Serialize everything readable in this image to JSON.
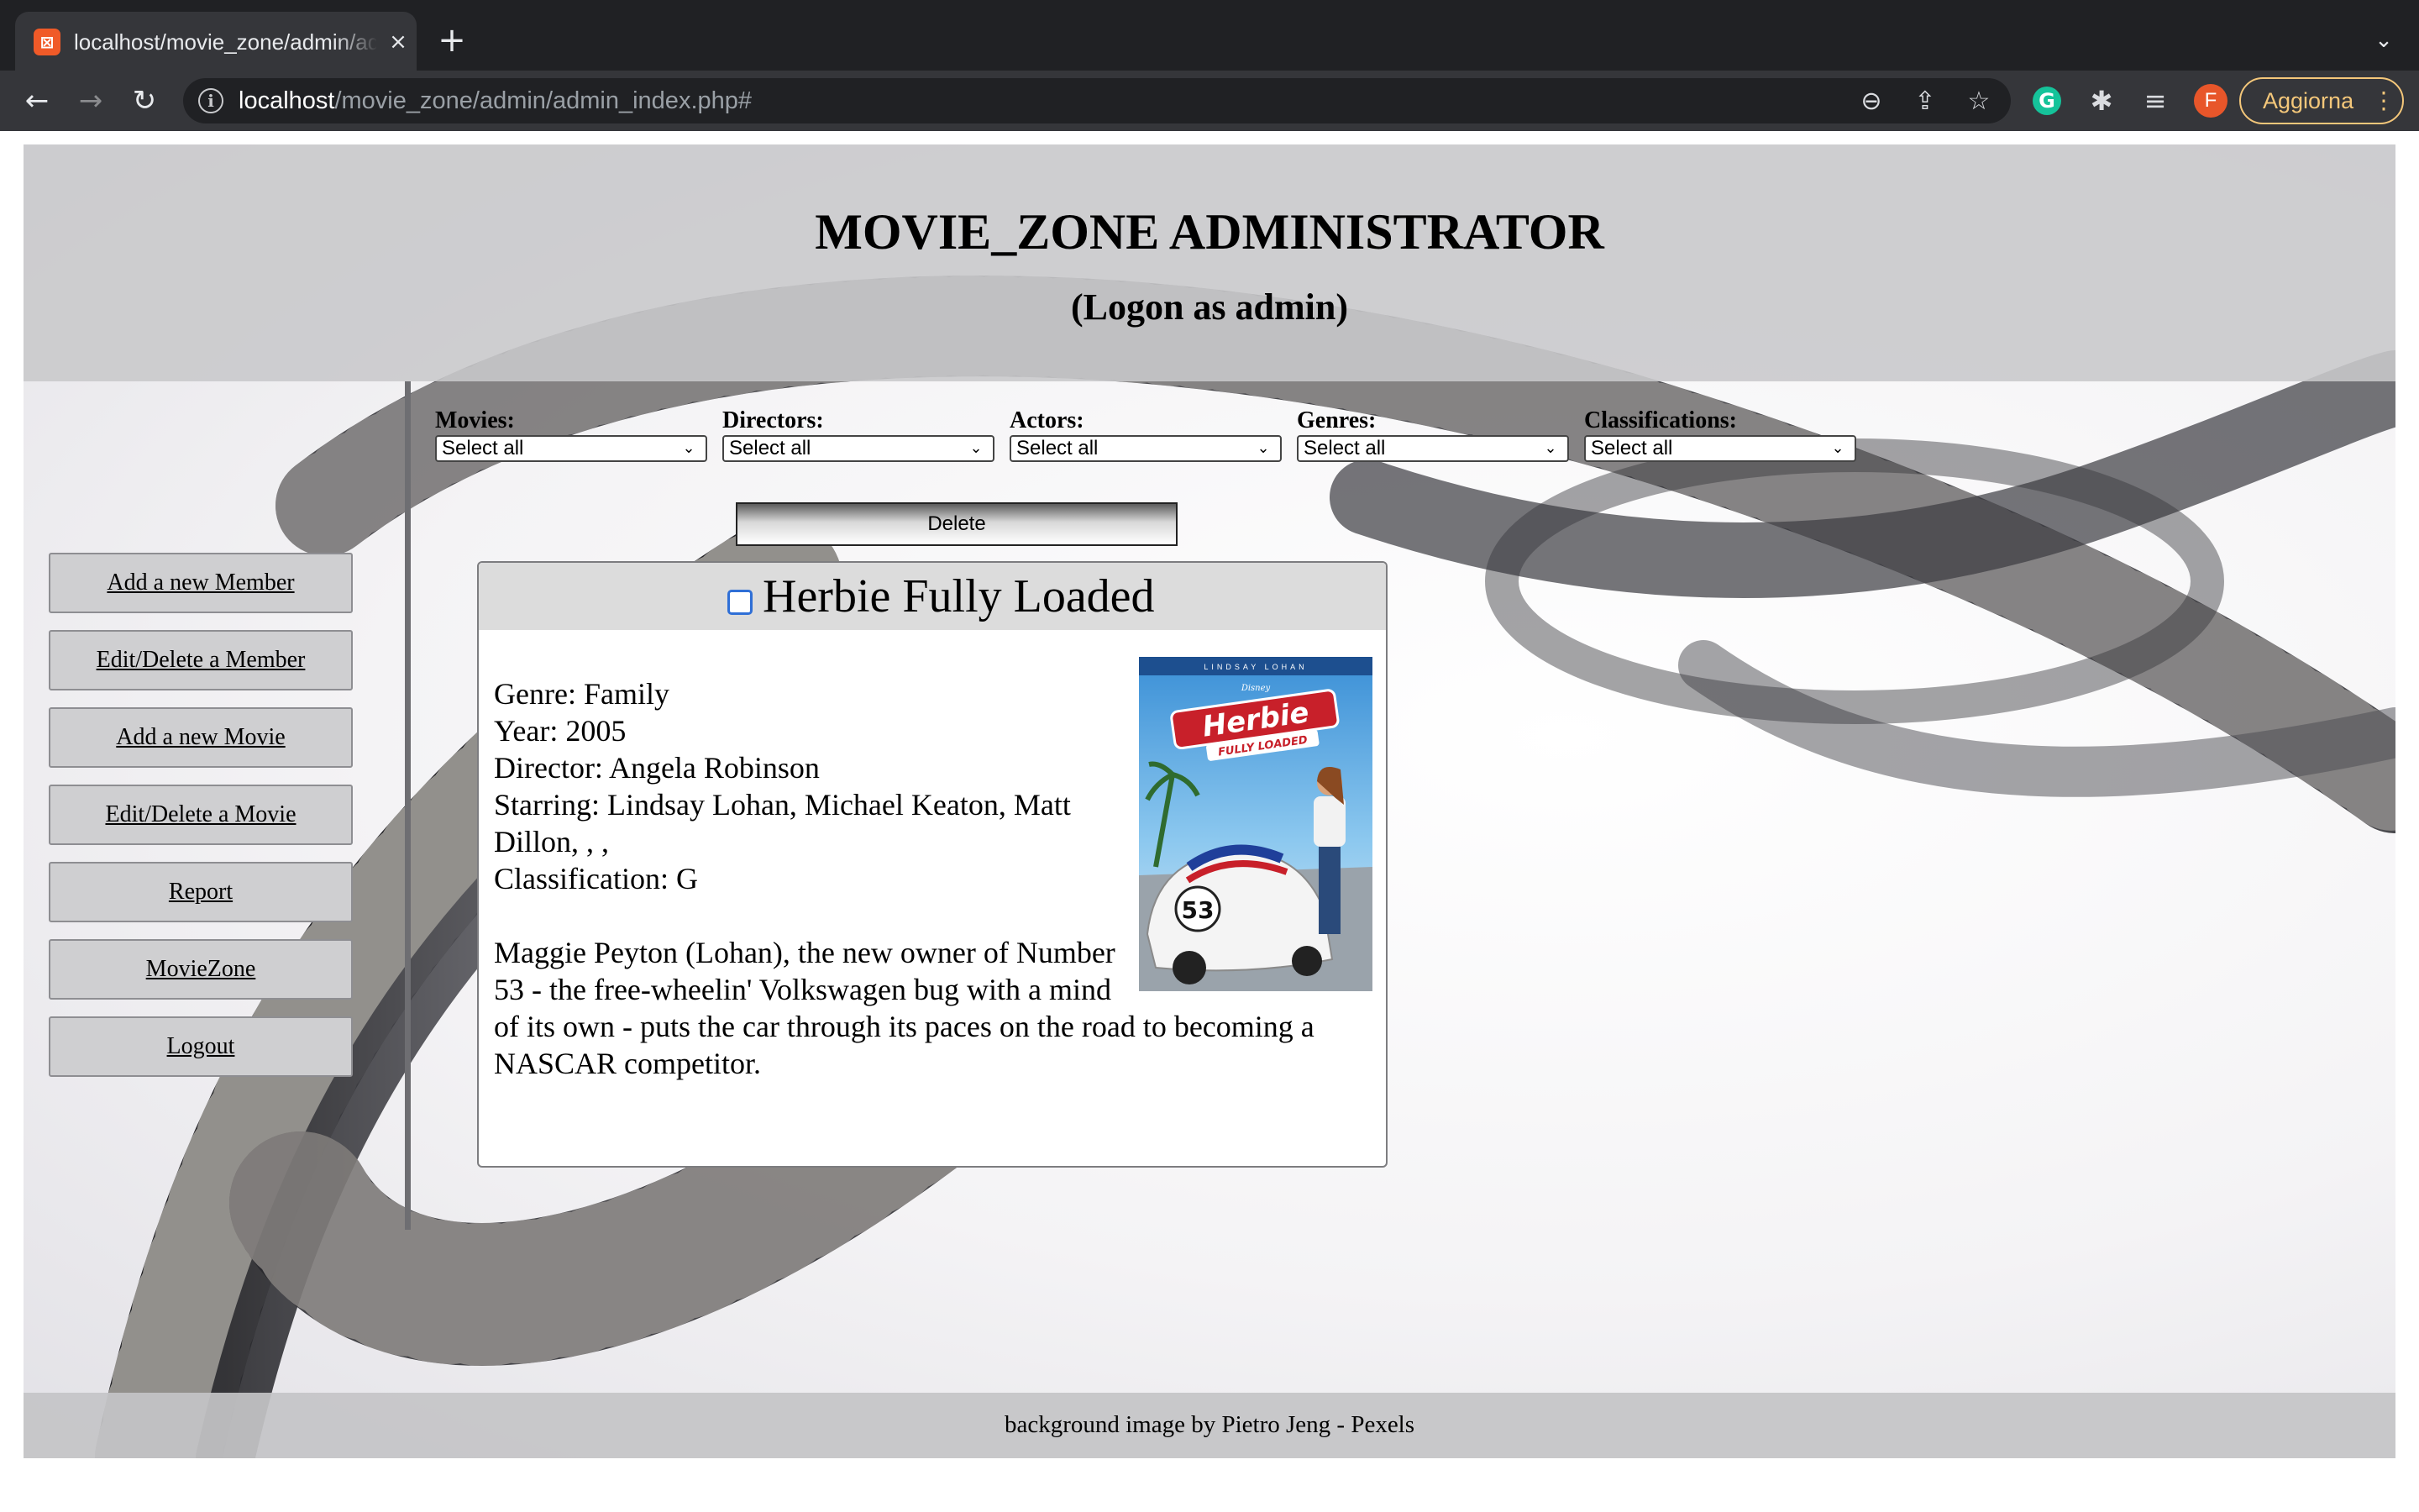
{
  "browser": {
    "tab_title": "localhost/movie_zone/admin/admin_index.php#",
    "tab_favicon": "xampp-icon",
    "tab_close": "×",
    "new_tab": "+",
    "tab_menu": "⌄",
    "back": "←",
    "forward": "→",
    "reload": "↻",
    "info": "i",
    "url_host": "localhost",
    "url_path": "/movie_zone/admin/admin_index.php#",
    "zoom_icon": "⊖",
    "share_icon": "⇪",
    "bookmark_icon": "☆",
    "grammarly_icon": "G",
    "extensions_icon": "✱",
    "media_icon": "≡",
    "profile_initial": "F",
    "update_label": "Aggiorna",
    "menu_icon": "⋮"
  },
  "header": {
    "title": "MOVIE_ZONE ADMINISTRATOR",
    "subtitle": "(Logon as admin)"
  },
  "sidebar": {
    "items": [
      {
        "label": "Add a new Member"
      },
      {
        "label": "Edit/Delete a Member"
      },
      {
        "label": "Add a new Movie"
      },
      {
        "label": "Edit/Delete a Movie"
      },
      {
        "label": "Report"
      },
      {
        "label": "MovieZone"
      },
      {
        "label": "Logout"
      }
    ]
  },
  "filters": [
    {
      "label": "Movies:",
      "value": "Select all"
    },
    {
      "label": "Directors:",
      "value": "Select all"
    },
    {
      "label": "Actors:",
      "value": "Select all"
    },
    {
      "label": "Genres:",
      "value": "Select all"
    },
    {
      "label": "Classifications:",
      "value": "Select all"
    }
  ],
  "select_chevron": "⌄",
  "delete_label": "Delete",
  "movie": {
    "title": "Herbie Fully Loaded",
    "checked": false,
    "genre": "Genre: Family",
    "year": "Year: 2005",
    "director": "Director: Angela Robinson",
    "starring": "Starring: Lindsay Lohan, Michael Keaton, Matt Dillon, , ,",
    "classification": "Classification: G",
    "plot": "Maggie Peyton (Lohan), the new owner of Number 53 - the free-wheelin' Volkswagen bug with a mind of its own - puts the car through its paces on the road to becoming a NASCAR competitor.",
    "poster": {
      "top_credit": "LINDSAY LOHAN",
      "brand": "Disney",
      "title_main": "Herbie",
      "title_sub": "FULLY LOADED",
      "car_number": "53"
    }
  },
  "footer": {
    "text": "background image by Pietro Jeng - Pexels"
  }
}
